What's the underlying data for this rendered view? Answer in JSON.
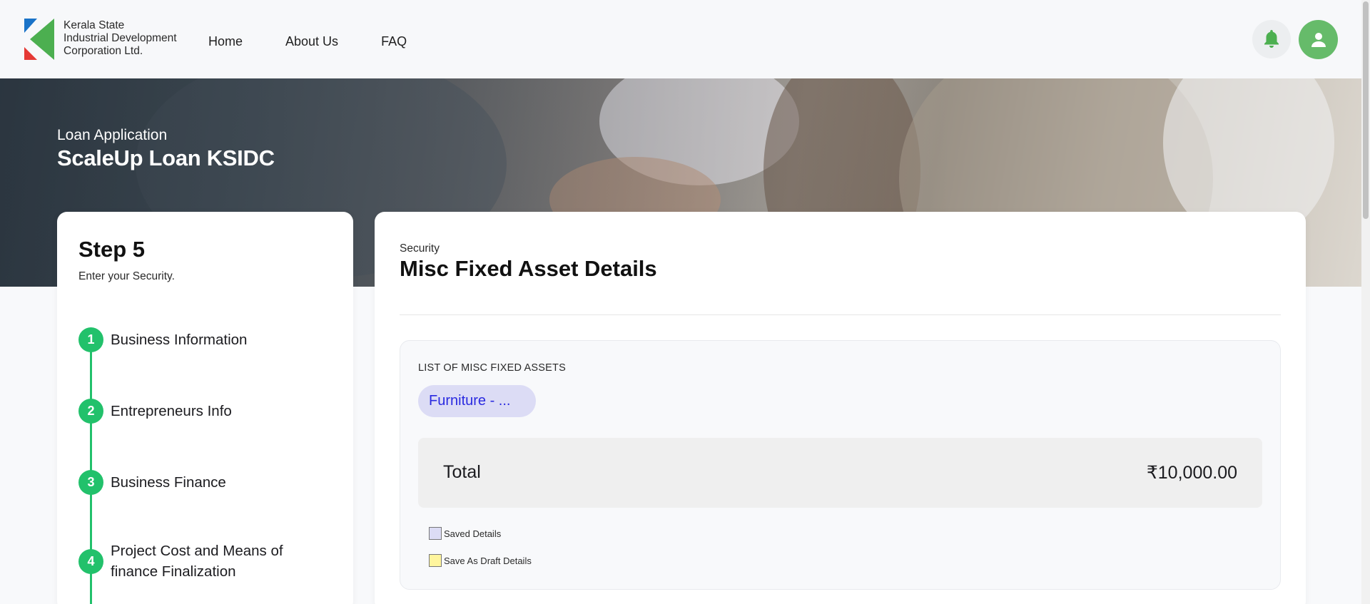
{
  "header": {
    "org_name_line1": "Kerala State",
    "org_name_line2": "Industrial Development",
    "org_name_line3": "Corporation Ltd.",
    "nav": [
      "Home",
      "About Us",
      "FAQ"
    ],
    "logo_icon": "ksidc-logo",
    "bell_icon": "bell-icon",
    "user_icon": "user-icon",
    "colors": {
      "logo_blue": "#1a73c8",
      "logo_green": "#4caf50",
      "logo_red": "#e53935",
      "avatar_bg": "#66bb6a",
      "bell_color": "#4caf50"
    }
  },
  "hero": {
    "subtitle": "Loan Application",
    "title": "ScaleUp Loan KSIDC"
  },
  "steps_panel": {
    "title": "Step 5",
    "description": "Enter your Security.",
    "accent": "#22c16b",
    "steps": [
      {
        "number": "1",
        "label": "Business Information"
      },
      {
        "number": "2",
        "label": "Entrepreneurs Info"
      },
      {
        "number": "3",
        "label": "Business Finance"
      },
      {
        "number": "4",
        "label": "Project Cost and Means of finance Finalization"
      }
    ]
  },
  "main": {
    "section_label": "Security",
    "section_title": "Misc Fixed Asset Details",
    "assets_heading": "LIST OF MISC FIXED ASSETS",
    "asset_chip": "Furniture - ...",
    "total_label": "Total",
    "total_value": "₹10,000.00",
    "legend": [
      {
        "label": "Saved Details",
        "color": "#dcdcf5"
      },
      {
        "label": "Save As Draft Details",
        "color": "#fff59d"
      }
    ]
  }
}
